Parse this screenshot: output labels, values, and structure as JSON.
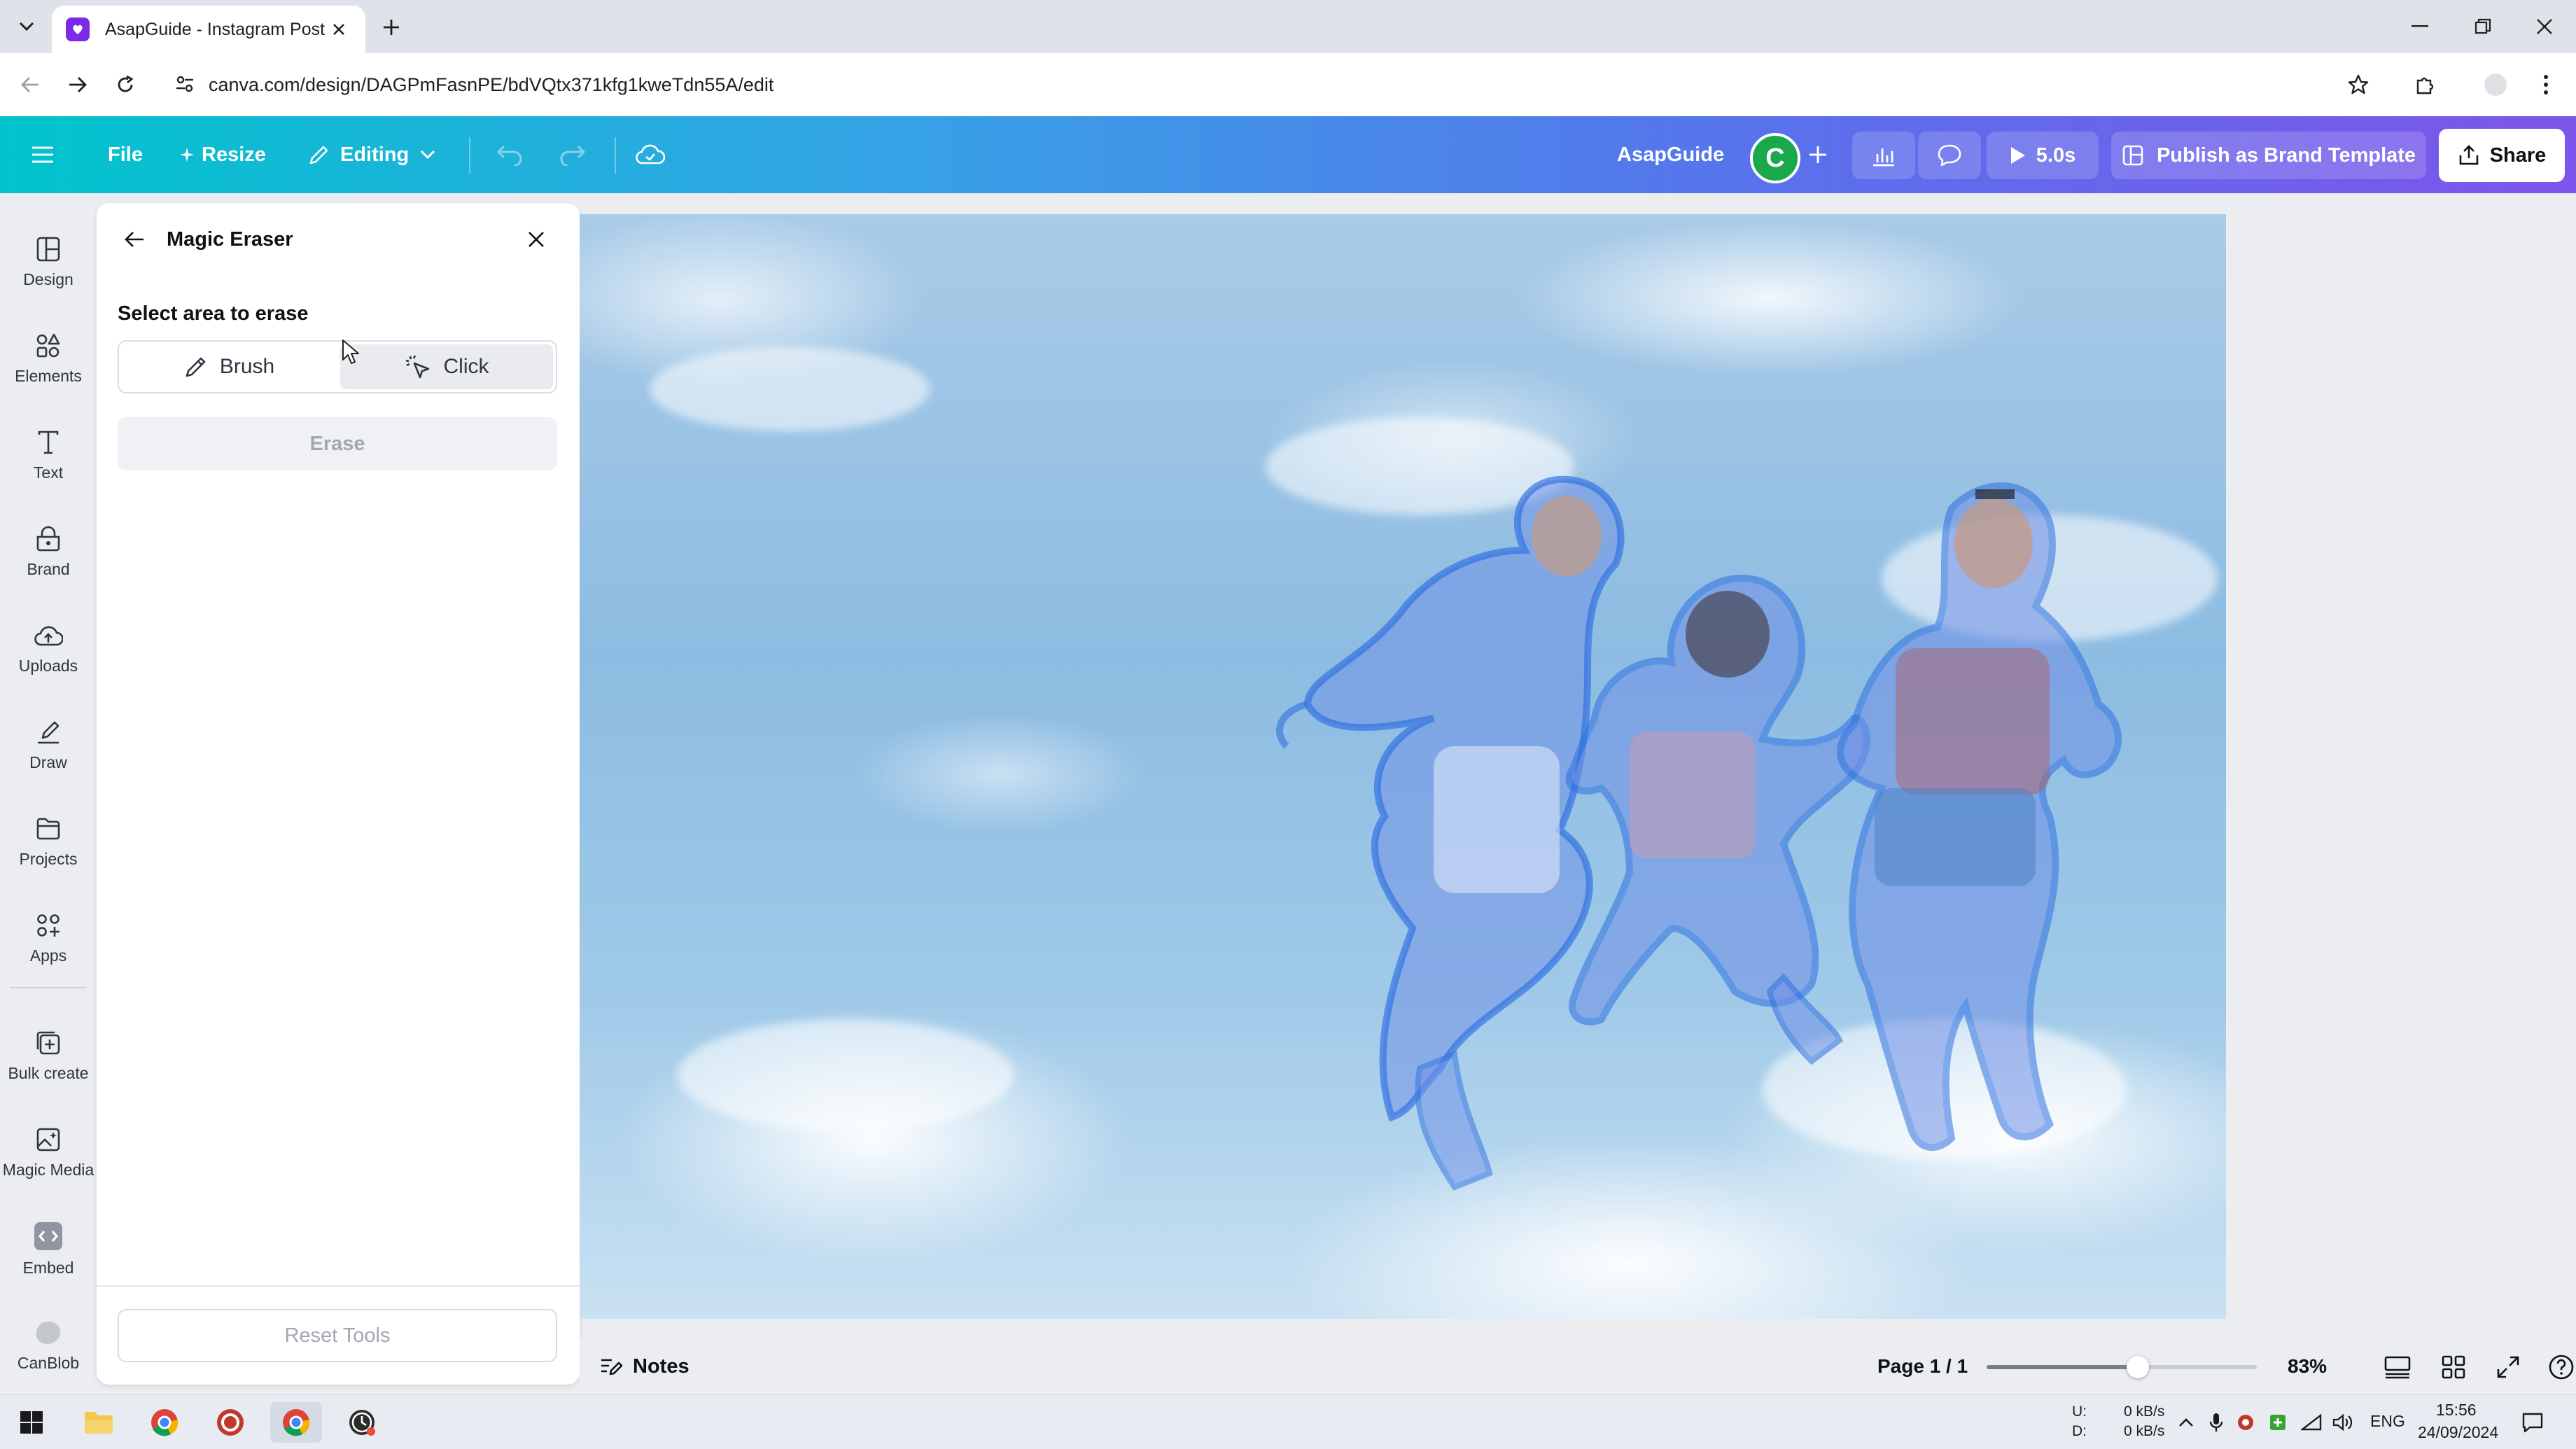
{
  "browser": {
    "tab_title": "AsapGuide - Instagram Post",
    "url": "canva.com/design/DAGPmFasnPE/bdVQtx371kfg1kweTdn55A/edit"
  },
  "toolbar": {
    "file_label": "File",
    "resize_label": "Resize",
    "editing_label": "Editing",
    "design_name": "AsapGuide",
    "avatar_initial": "C",
    "timer_label": "5.0s",
    "publish_label": "Publish as Brand Template",
    "share_label": "Share"
  },
  "sidebar": {
    "items": [
      {
        "label": "Design",
        "icon": "design-icon"
      },
      {
        "label": "Elements",
        "icon": "elements-icon"
      },
      {
        "label": "Text",
        "icon": "text-icon"
      },
      {
        "label": "Brand",
        "icon": "brand-icon"
      },
      {
        "label": "Uploads",
        "icon": "uploads-icon"
      },
      {
        "label": "Draw",
        "icon": "draw-icon"
      },
      {
        "label": "Projects",
        "icon": "projects-icon"
      },
      {
        "label": "Apps",
        "icon": "apps-icon"
      },
      {
        "label": "Bulk create",
        "icon": "bulk-create-icon"
      },
      {
        "label": "Magic Media",
        "icon": "magic-media-icon"
      },
      {
        "label": "Embed",
        "icon": "embed-icon"
      },
      {
        "label": "CanBlob",
        "icon": "canblob-icon"
      }
    ]
  },
  "panel": {
    "title": "Magic Eraser",
    "select_label": "Select area to erase",
    "brush_label": "Brush",
    "click_label": "Click",
    "selected_mode": "Click",
    "erase_label": "Erase",
    "reset_label": "Reset Tools"
  },
  "bottom": {
    "notes_label": "Notes",
    "page_indicator": "Page 1 / 1",
    "zoom_label": "83%",
    "zoom_fraction": 0.56
  },
  "taskbar": {
    "net_up_label": "U:",
    "net_down_label": "D:",
    "net_up": "0 kB/s",
    "net_down": "0 kB/s",
    "language": "ENG",
    "time": "15:56",
    "date": "24/09/2024"
  },
  "colors": {
    "brand_teal": "#00c4cc",
    "brand_purple": "#7d55ea",
    "selection_blue": "#3b82f6",
    "avatar_green": "#1aa84c"
  }
}
